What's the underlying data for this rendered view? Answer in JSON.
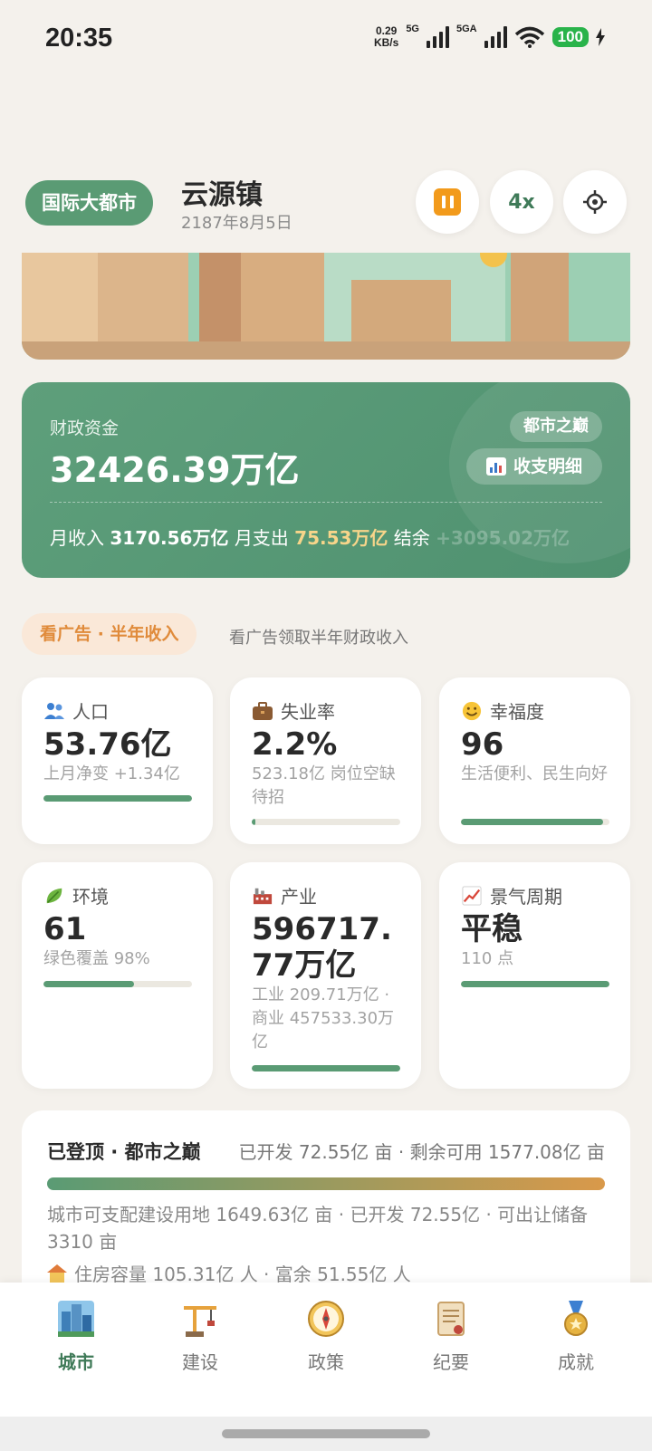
{
  "status_bar": {
    "time": "20:35",
    "speed_value": "0.29",
    "speed_unit": "KB/s",
    "net1": "5G",
    "net2": "5GA",
    "battery": "100"
  },
  "header": {
    "rank": "国际大都市",
    "town": "云源镇",
    "date": "2187年8月5日",
    "speed": "4x"
  },
  "finance": {
    "label": "财政资金",
    "amount": "32426.39万亿",
    "badge": "都市之巅",
    "detail_button": "收支明细",
    "income_label": "月收入",
    "income": "3170.56万亿",
    "expense_label": "月支出",
    "expense": "75.53万亿",
    "balance_label": "结余",
    "balance": "+3095.02万亿"
  },
  "ad": {
    "button": "看广告 · 半年收入",
    "hint": "看广告领取半年财政收入"
  },
  "stats": [
    {
      "title": "人口",
      "icon": "people-icon",
      "value": "53.76亿",
      "sub": "上月净变 +1.34亿",
      "progress": 1.0
    },
    {
      "title": "失业率",
      "icon": "briefcase-icon",
      "value": "2.2%",
      "sub": "523.18亿 岗位空缺待招",
      "progress": 0.022
    },
    {
      "title": "幸福度",
      "icon": "smile-icon",
      "value": "96",
      "sub": "生活便利、民生向好",
      "progress": 0.96
    },
    {
      "title": "环境",
      "icon": "leaf-icon",
      "value": "61",
      "sub": "绿色覆盖 98%",
      "progress": 0.61
    },
    {
      "title": "产业",
      "icon": "factory-icon",
      "value": "596717.77万亿",
      "sub": "工业 209.71万亿 · 商业 457533.30万亿",
      "progress": 1.0
    },
    {
      "title": "景气周期",
      "icon": "trend-chart-icon",
      "value": "平稳",
      "sub": "110 点",
      "progress": 1.0
    }
  ],
  "land": {
    "title": "已登顶 · 都市之巅",
    "summary": "已开发 72.55亿 亩 · 剩余可用 1577.08亿 亩",
    "detail": "城市可支配建设用地 1649.63亿 亩 · 已开发 72.55亿 · 可出让储备 3310 亩",
    "housing": "住房容量 105.31亿 人 · 富余 51.55亿 人"
  },
  "nav": [
    {
      "label": "城市",
      "icon": "city-icon",
      "active": true
    },
    {
      "label": "建设",
      "icon": "crane-icon",
      "active": false
    },
    {
      "label": "政策",
      "icon": "compass-icon",
      "active": false
    },
    {
      "label": "纪要",
      "icon": "scroll-icon",
      "active": false
    },
    {
      "label": "成就",
      "icon": "medal-icon",
      "active": false
    }
  ],
  "colors": {
    "accent": "#5a9b74",
    "orange": "#f29a1b",
    "ad_text": "#e08b3b",
    "expense": "#f7d58a"
  }
}
